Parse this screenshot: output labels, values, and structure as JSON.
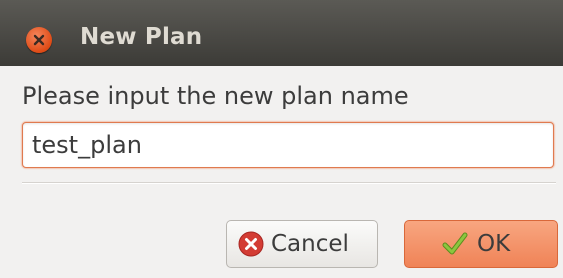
{
  "window": {
    "title": "New Plan",
    "close_icon": "close-icon"
  },
  "form": {
    "prompt": "Please input the new plan name",
    "plan_name_value": "test_plan"
  },
  "buttons": {
    "cancel_label": "Cancel",
    "cancel_icon": "cancel-icon",
    "ok_label": "OK",
    "ok_icon": "checkmark-icon"
  },
  "colors": {
    "titlebar": "#3c3b37",
    "accent": "#f07746",
    "cancel_icon": "#d33c34",
    "ok_check": "#7fb52b"
  }
}
